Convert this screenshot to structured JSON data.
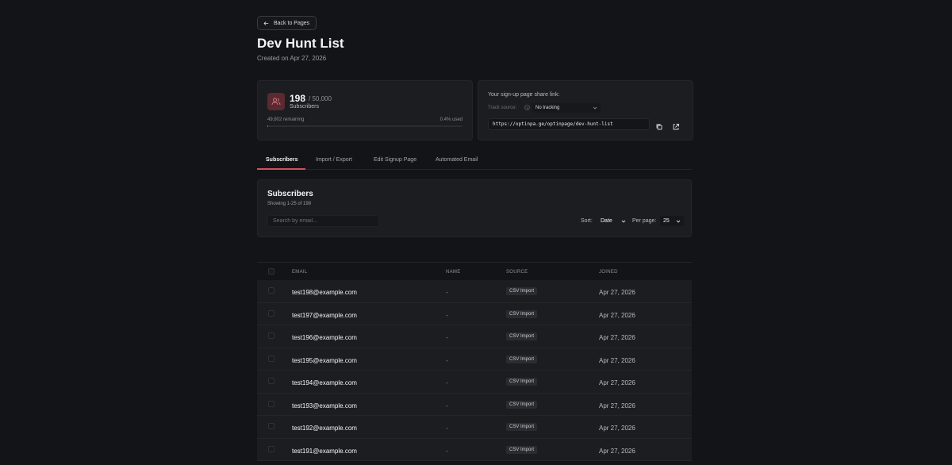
{
  "back_label": "Back to Pages",
  "page": {
    "title": "Dev Hunt List",
    "created": "Created on Apr 27, 2026"
  },
  "stats": {
    "count": "198",
    "limit": "/ 50,000",
    "label": "Subscribers",
    "remaining": "49,802 remaining",
    "used": "0.4% used",
    "used_fraction": 0.004
  },
  "share": {
    "title": "Your sign-up page share link:",
    "track_label": "Track source:",
    "track_value": "No tracking",
    "url": "https://optinpa.ge/optinpage/dev-hunt-list"
  },
  "tabs": [
    "Subscribers",
    "Import / Export",
    "Edit Signup Page",
    "Automated Email"
  ],
  "subscribers": {
    "title": "Subscribers",
    "showing": "Showing 1-25 of 198",
    "search_placeholder": "Search by email...",
    "sort_label": "Sort:",
    "sort_value": "Date",
    "per_page_label": "Per page:",
    "per_page_value": "25"
  },
  "table": {
    "columns": [
      "EMAIL",
      "NAME",
      "SOURCE",
      "JOINED"
    ],
    "rows": [
      {
        "email": "test198@example.com",
        "name": "-",
        "source": "CSV Import",
        "joined": "Apr 27, 2026"
      },
      {
        "email": "test197@example.com",
        "name": "-",
        "source": "CSV Import",
        "joined": "Apr 27, 2026"
      },
      {
        "email": "test196@example.com",
        "name": "-",
        "source": "CSV Import",
        "joined": "Apr 27, 2026"
      },
      {
        "email": "test195@example.com",
        "name": "-",
        "source": "CSV Import",
        "joined": "Apr 27, 2026"
      },
      {
        "email": "test194@example.com",
        "name": "-",
        "source": "CSV Import",
        "joined": "Apr 27, 2026"
      },
      {
        "email": "test193@example.com",
        "name": "-",
        "source": "CSV Import",
        "joined": "Apr 27, 2026"
      },
      {
        "email": "test192@example.com",
        "name": "-",
        "source": "CSV Import",
        "joined": "Apr 27, 2026"
      },
      {
        "email": "test191@example.com",
        "name": "-",
        "source": "CSV Import",
        "joined": "Apr 27, 2026"
      }
    ]
  },
  "colors": {
    "accent": "#d44e5e",
    "background": "#131417",
    "card": "#1b1d21"
  }
}
